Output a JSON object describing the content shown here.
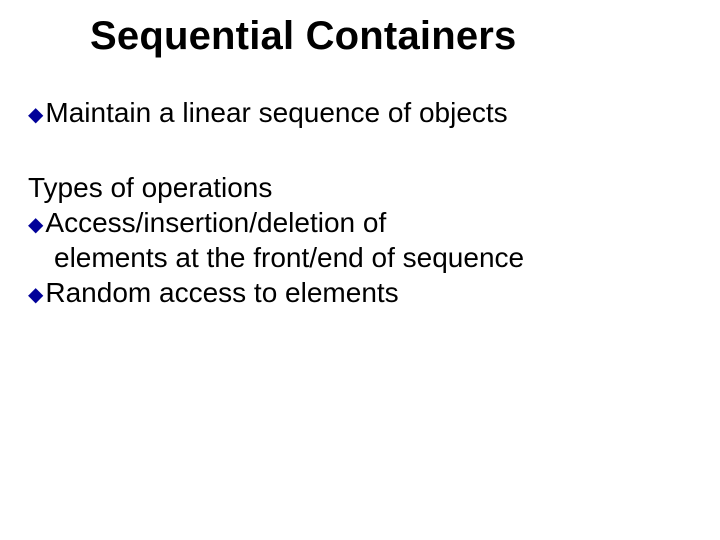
{
  "title": "Sequential Containers",
  "bullets": {
    "b1": "Maintain a linear sequence of objects"
  },
  "section": "Types of operations",
  "ops": {
    "b2_line1": "Access/insertion/deletion of",
    "b2_line2": "elements at the front/end of sequence",
    "b3": "Random access to elements"
  },
  "icon": "◆"
}
